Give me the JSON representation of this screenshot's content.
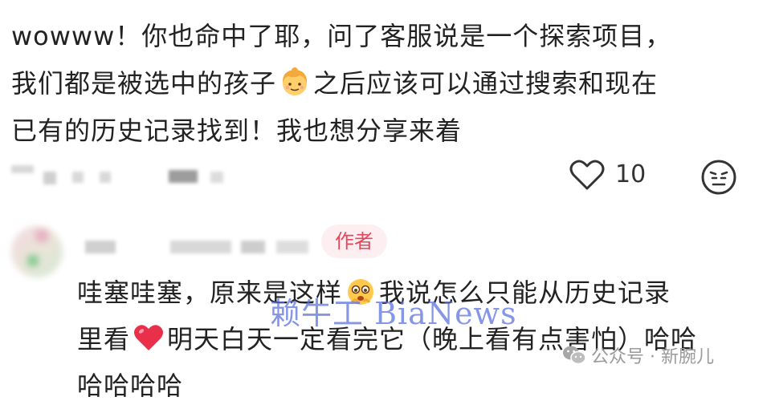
{
  "comment": {
    "line1": "wowww！你也命中了耶，问了客服说是一个探索项目，",
    "line2_before": "我们都是被选中的孩子",
    "line2_after": "之后应该可以通过搜索和现在",
    "line3": "已有的历史记录找到！我也想分享来着",
    "emoji": "girl-face-icon",
    "likes": "10"
  },
  "reply": {
    "author_badge": "作者",
    "line1_before": "哇塞哇塞，原来是这样",
    "line1_after": "我说怎么只能从历史记录",
    "line2_before": "里看",
    "line2_after": "明天白天一定看完它（晚上看有点害怕）哈哈",
    "line3": "哈哈哈哈"
  },
  "watermark": {
    "text": "赖牛工 BiaNews",
    "color": "#586edc"
  },
  "wechat_source": {
    "label": "公众号 · 新腕儿"
  },
  "colors": {
    "author_badge_bg": "#fdeff1",
    "author_badge_text": "#e5475b",
    "heart": "#e8304a"
  }
}
